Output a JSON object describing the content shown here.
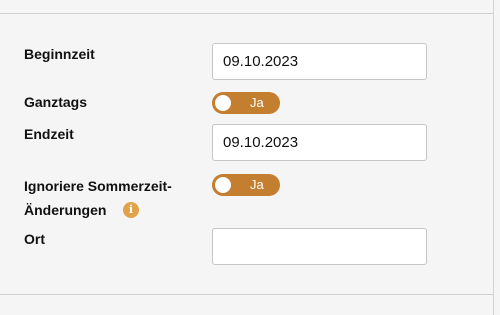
{
  "form": {
    "start_time": {
      "label": "Beginnzeit",
      "value": "09.10.2023"
    },
    "all_day": {
      "label": "Ganztags",
      "toggle_text": "Ja"
    },
    "end_time": {
      "label": "Endzeit",
      "value": "09.10.2023"
    },
    "ignore_dst": {
      "label_line1": "Ignoriere Sommerzeit-",
      "label_line2": "Änderungen",
      "toggle_text": "Ja",
      "info_icon": "info-icon",
      "info_glyph": "i"
    },
    "location": {
      "label": "Ort",
      "value": ""
    }
  },
  "colors": {
    "toggle_accent": "#c47e2f",
    "info_icon": "#e1a24a",
    "background": "#f5f5f5"
  }
}
